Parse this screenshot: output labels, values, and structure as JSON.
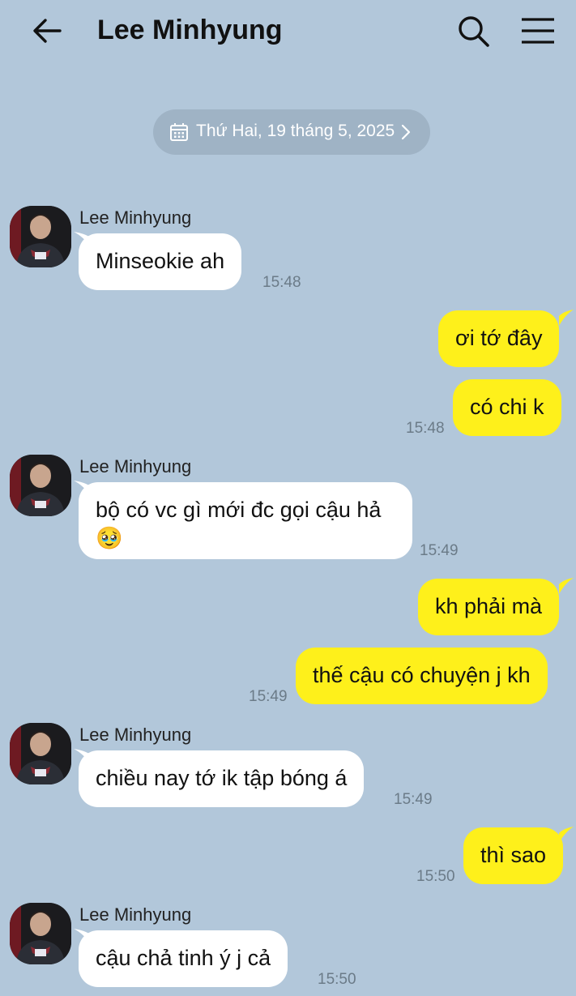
{
  "header": {
    "title": "Lee Minhyung",
    "back_icon": "arrow-left-icon",
    "search_icon": "search-icon",
    "menu_icon": "hamburger-menu-icon"
  },
  "date_divider": {
    "label": "Thứ Hai, 19 tháng 5, 2025",
    "icon": "calendar-icon"
  },
  "colors": {
    "background": "#b2c7da",
    "incoming_bubble": "#ffffff",
    "outgoing_bubble": "#fef01b",
    "date_pill": "#9fb3c5"
  },
  "messages": [
    {
      "from": "Lee Minhyung",
      "direction": "in",
      "text": "Minseokie ah",
      "time": "15:48"
    },
    {
      "direction": "out",
      "text": "ơi tớ đây"
    },
    {
      "direction": "out",
      "text": "có chi k",
      "time": "15:48"
    },
    {
      "from": "Lee Minhyung",
      "direction": "in",
      "text": "bộ có vc gì mới đc gọi cậu hả 🥹",
      "time": "15:49"
    },
    {
      "direction": "out",
      "text": "kh phải mà"
    },
    {
      "direction": "out",
      "text": "thế cậu có chuyện j kh",
      "time": "15:49"
    },
    {
      "from": "Lee Minhyung",
      "direction": "in",
      "text": "chiều nay tớ ik tập bóng á",
      "time": "15:49"
    },
    {
      "direction": "out",
      "text": "thì sao",
      "time": "15:50"
    },
    {
      "from": "Lee Minhyung",
      "direction": "in",
      "text": "cậu chả tinh ý j cả",
      "time": "15:50"
    }
  ]
}
